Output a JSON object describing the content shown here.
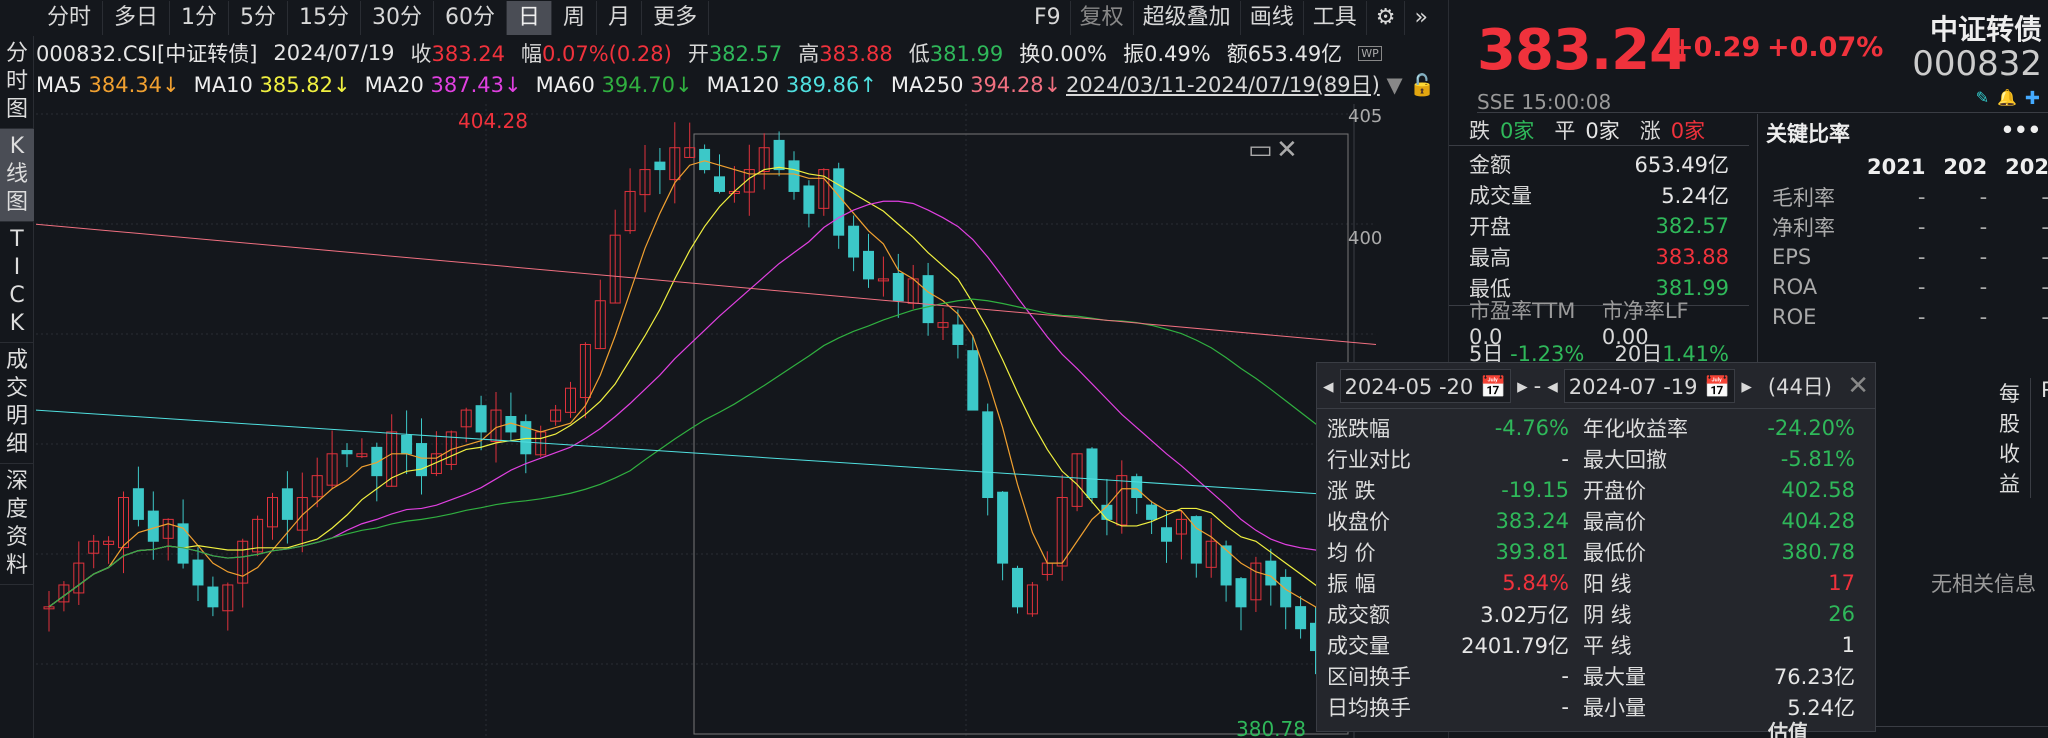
{
  "period_tabs": [
    "分时",
    "多日",
    "1分",
    "5分",
    "15分",
    "30分",
    "60分",
    "日",
    "周",
    "月",
    "更多"
  ],
  "active_period": "日",
  "toolbar": [
    "F9",
    "复权",
    "超级叠加",
    "画线",
    "工具"
  ],
  "left_tabs": [
    "分时图",
    "K线图",
    "TICK",
    "成交明细",
    "深度资料"
  ],
  "info": {
    "code": "000832.CSI[中证转债]",
    "date": "2024/07/19",
    "close_label": "收",
    "close": "383.24",
    "chg_label": "幅",
    "chg": "0.07%(0.28)",
    "open_label": "开",
    "open": "382.57",
    "high_label": "高",
    "high": "383.88",
    "low_label": "低",
    "low": "381.99",
    "turn": "换0.00%",
    "amp": "振0.49%",
    "amount": "额653.49亿"
  },
  "ma": [
    {
      "name": "MA5",
      "value": "384.34↓",
      "color": "#f0a030"
    },
    {
      "name": "MA10",
      "value": "385.82↓",
      "color": "#f0f040"
    },
    {
      "name": "MA20",
      "value": "387.43↓",
      "color": "#e040e0"
    },
    {
      "name": "MA60",
      "value": "394.70↓",
      "color": "#30b040"
    },
    {
      "name": "MA120",
      "value": "389.86↑",
      "color": "#50e0e0"
    },
    {
      "name": "MA250",
      "value": "394.28↓",
      "color": "#f07080"
    }
  ],
  "range_label": "2024/03/11-2024/07/19(89日)",
  "chart": {
    "y_labels": [
      "405",
      "400"
    ],
    "max_label": "404.28",
    "min_label": "380.78"
  },
  "quote": {
    "price": "383.24",
    "change": "+0.29",
    "pct": "+0.07%",
    "name": "中证转债",
    "code": "000832",
    "exchange_time": "SSE  15:00:08"
  },
  "breadth": {
    "down_label": "跌",
    "down": "0家",
    "flat_label": "平",
    "flat": "0家",
    "up_label": "涨",
    "up": "0家"
  },
  "stats": [
    {
      "label": "金额",
      "value": "653.49亿",
      "color": "white"
    },
    {
      "label": "成交量",
      "value": "5.24亿",
      "color": "white"
    },
    {
      "label": "开盘",
      "value": "382.57",
      "color": "green"
    },
    {
      "label": "最高",
      "value": "383.88",
      "color": "red"
    },
    {
      "label": "最低",
      "value": "381.99",
      "color": "green"
    }
  ],
  "valuation": {
    "pe_label": "市盈率TTM",
    "pe": "0.0",
    "pb_label": "市净率LF",
    "pb": "0.00",
    "d5_label": "5日",
    "d5": "-1.23%",
    "d20_label": "20日",
    "d20": "1.41%"
  },
  "key_ratios": {
    "title": "关键比率",
    "years": [
      "2021",
      "202",
      "202"
    ],
    "rows": [
      {
        "label": "毛利率",
        "values": [
          "-",
          "-",
          "-"
        ]
      },
      {
        "label": "净利率",
        "values": [
          "-",
          "-",
          "-"
        ]
      },
      {
        "label": "EPS",
        "values": [
          "-",
          "-",
          "-"
        ]
      },
      {
        "label": "ROA",
        "values": [
          "-",
          "-",
          "-"
        ]
      },
      {
        "label": "ROE",
        "values": [
          "-",
          "-",
          "-"
        ]
      }
    ]
  },
  "sub_tabs": [
    "每股收益",
    "PE"
  ],
  "no_info": "无相关信息",
  "popup": {
    "start": "2024-05 -20",
    "end": "2024-07 -19",
    "days": "(44日)",
    "rows": [
      {
        "l": "涨跌幅",
        "v": "-4.76%",
        "vc": "green",
        "l2": "年化收益率",
        "v2": "-24.20%",
        "v2c": "green"
      },
      {
        "l": "行业对比",
        "v": "-",
        "vc": "white",
        "l2": "最大回撤",
        "v2": "-5.81%",
        "v2c": "green"
      },
      {
        "l": "涨  跌",
        "v": "-19.15",
        "vc": "green",
        "l2": "开盘价",
        "v2": "402.58",
        "v2c": "green"
      },
      {
        "l": "收盘价",
        "v": "383.24",
        "vc": "green",
        "l2": "最高价",
        "v2": "404.28",
        "v2c": "green"
      },
      {
        "l": "均  价",
        "v": "393.81",
        "vc": "green",
        "l2": "最低价",
        "v2": "380.78",
        "v2c": "green"
      },
      {
        "l": "振  幅",
        "v": "5.84%",
        "vc": "red",
        "l2": "阳  线",
        "v2": "17",
        "v2c": "red"
      },
      {
        "l": "成交额",
        "v": "3.02万亿",
        "vc": "white",
        "l2": "阴  线",
        "v2": "26",
        "v2c": "green"
      },
      {
        "l": "成交量",
        "v": "2401.79亿",
        "vc": "white",
        "l2": "平 线",
        "v2": "1",
        "v2c": "white"
      },
      {
        "l": "区间换手",
        "v": "-",
        "vc": "white",
        "l2": "最大量",
        "v2": "76.23亿",
        "v2c": "white"
      },
      {
        "l": "日均换手",
        "v": "-",
        "vc": "white",
        "l2": "最小量",
        "v2": "5.24亿",
        "v2c": "white"
      }
    ]
  },
  "bottom": {
    "partial": "估值"
  }
}
